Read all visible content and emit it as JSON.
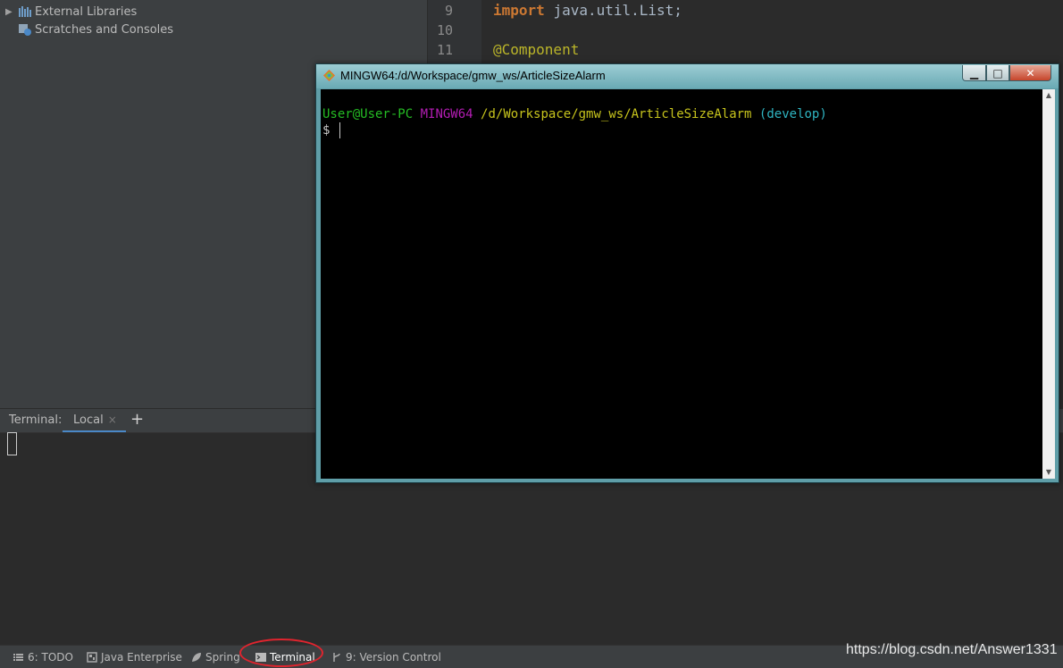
{
  "project_tree": {
    "items": [
      {
        "label": "External Libraries",
        "expandable": true
      },
      {
        "label": "Scratches and Consoles",
        "expandable": false
      }
    ]
  },
  "editor": {
    "line_numbers": [
      "9",
      "10",
      "11"
    ],
    "code": {
      "import_keyword": "import",
      "import_path": "java.util.List;",
      "annotation": "@Component"
    }
  },
  "tool_terminal": {
    "title": "Terminal:",
    "tab_label": "Local",
    "tab_close": "×",
    "add_tab": "+"
  },
  "mingw": {
    "title": "MINGW64:/d/Workspace/gmw_ws/ArticleSizeAlarm",
    "prompt": {
      "user_host": "User@User-PC",
      "system": "MINGW64",
      "path": "/d/Workspace/gmw_ws/ArticleSizeAlarm",
      "branch": "(develop)",
      "symbol": "$"
    },
    "controls": {
      "minimize": "▁",
      "maximize": "□",
      "close": "✕"
    }
  },
  "tool_strip": {
    "buttons": [
      {
        "label": "6: TODO",
        "icon": "list-icon"
      },
      {
        "label": "Java Enterprise",
        "icon": "java-enterprise-icon"
      },
      {
        "label": "Spring",
        "icon": "spring-leaf-icon"
      },
      {
        "label": "Terminal",
        "icon": "terminal-icon"
      },
      {
        "label": "9: Version Control",
        "icon": "vcs-branch-icon"
      }
    ]
  },
  "watermark": "https://blog.csdn.net/Answer1331",
  "colors": {
    "highlight_circle": "#e0242e",
    "prompt_user": "#25bc24",
    "prompt_system": "#b31db3",
    "prompt_path": "#c7c41d",
    "prompt_branch": "#2fb5c2"
  }
}
